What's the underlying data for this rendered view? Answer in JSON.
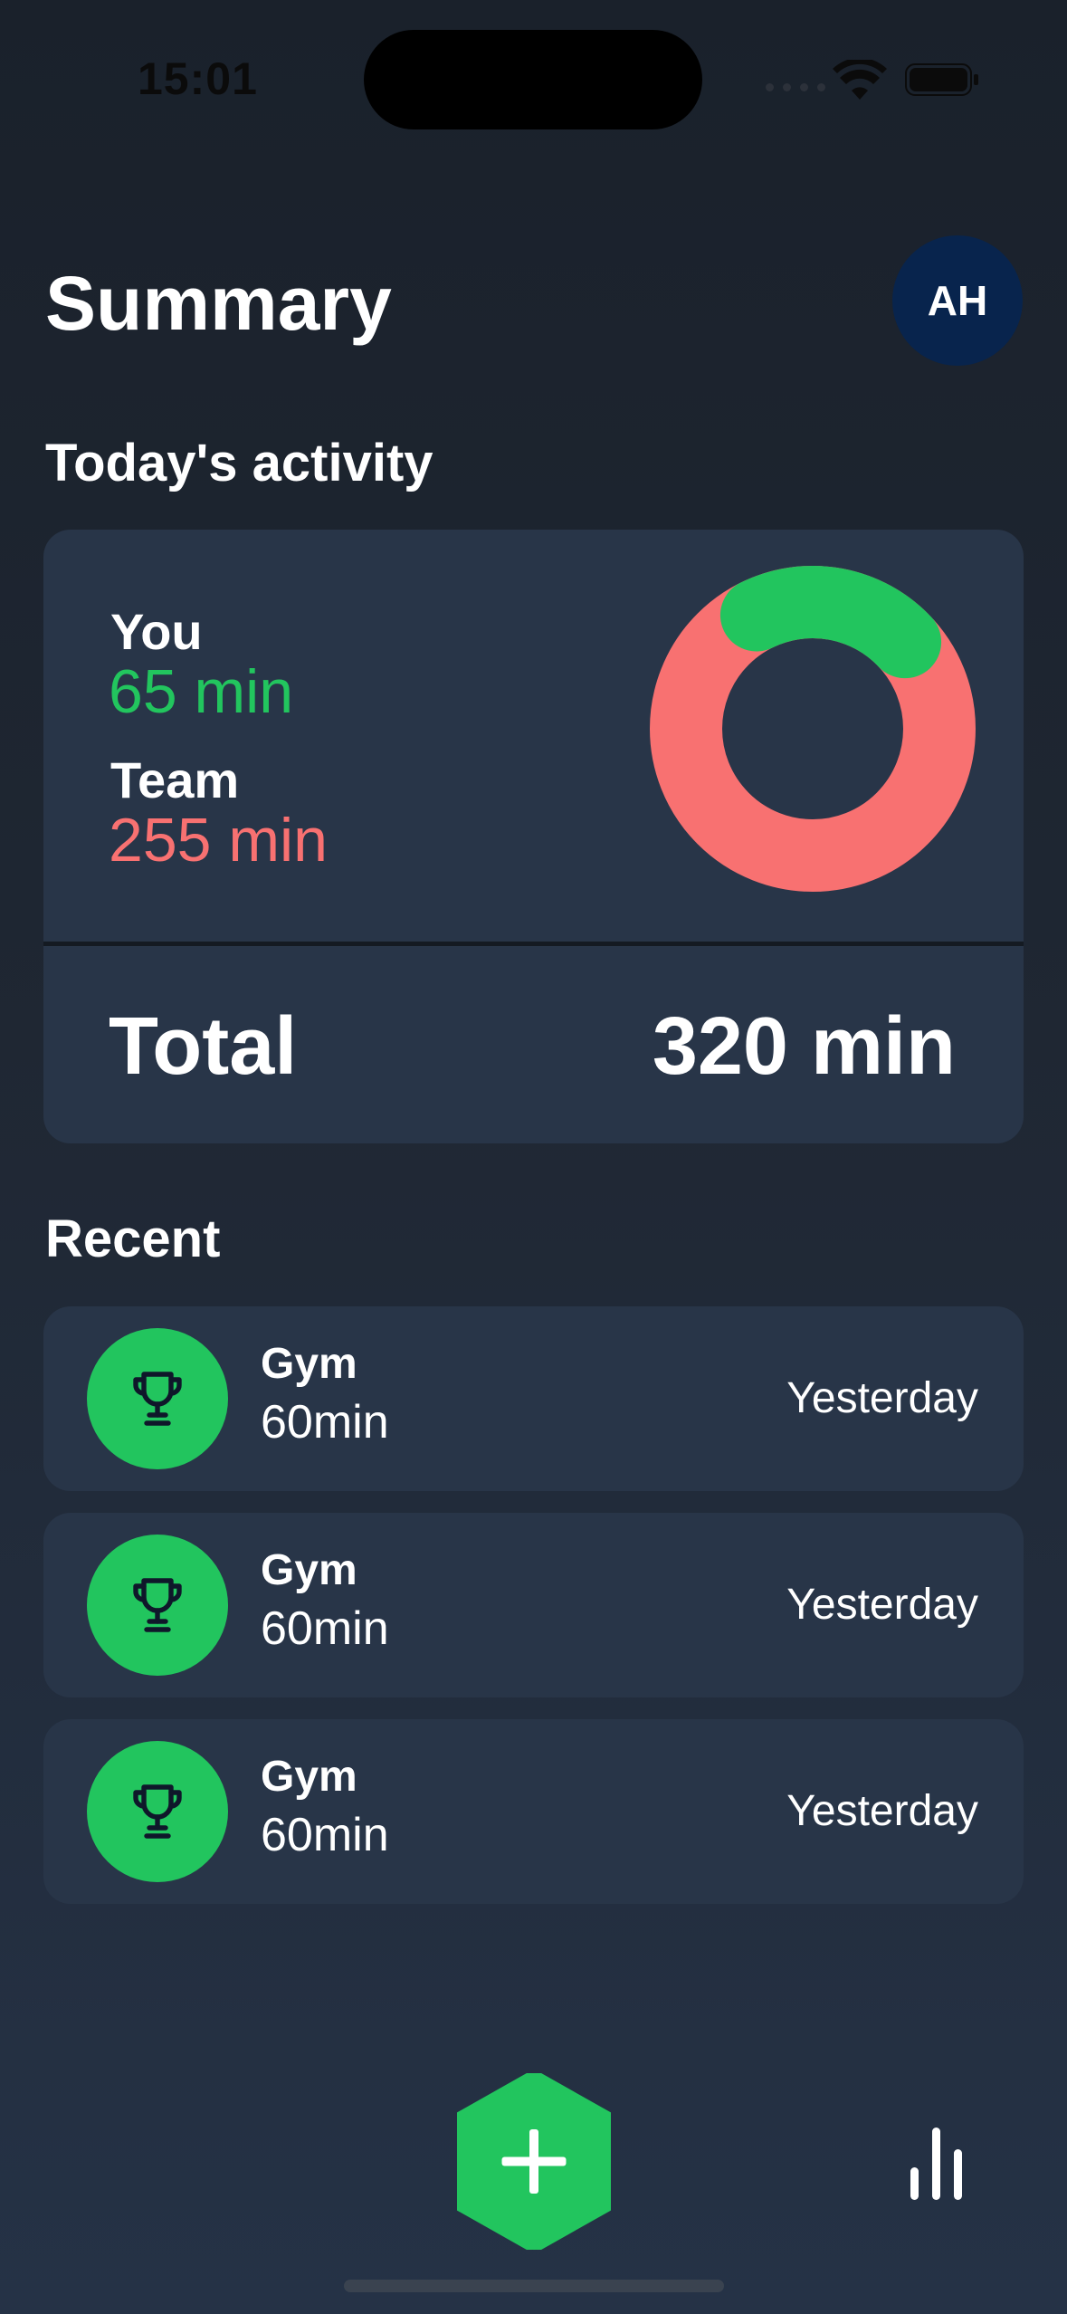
{
  "status_bar": {
    "time": "15:01"
  },
  "header": {
    "title": "Summary",
    "avatar_initials": "AH"
  },
  "activity": {
    "section_title": "Today's activity",
    "you_label": "You",
    "you_value": "65 min",
    "team_label": "Team",
    "team_value": "255 min",
    "total_label": "Total",
    "total_value": "320 min",
    "colors": {
      "you": "#22c55e",
      "team": "#f87171"
    },
    "you_minutes": 65,
    "team_minutes": 255
  },
  "recent": {
    "section_title": "Recent",
    "items": [
      {
        "title": "Gym",
        "duration": "60min",
        "date": "Yesterday",
        "icon": "trophy-icon"
      },
      {
        "title": "Gym",
        "duration": "60min",
        "date": "Yesterday",
        "icon": "trophy-icon"
      },
      {
        "title": "Gym",
        "duration": "60min",
        "date": "Yesterday",
        "icon": "trophy-icon"
      }
    ]
  },
  "bottom_bar": {
    "add_icon": "plus-icon",
    "stats_icon": "bar-chart-icon"
  }
}
